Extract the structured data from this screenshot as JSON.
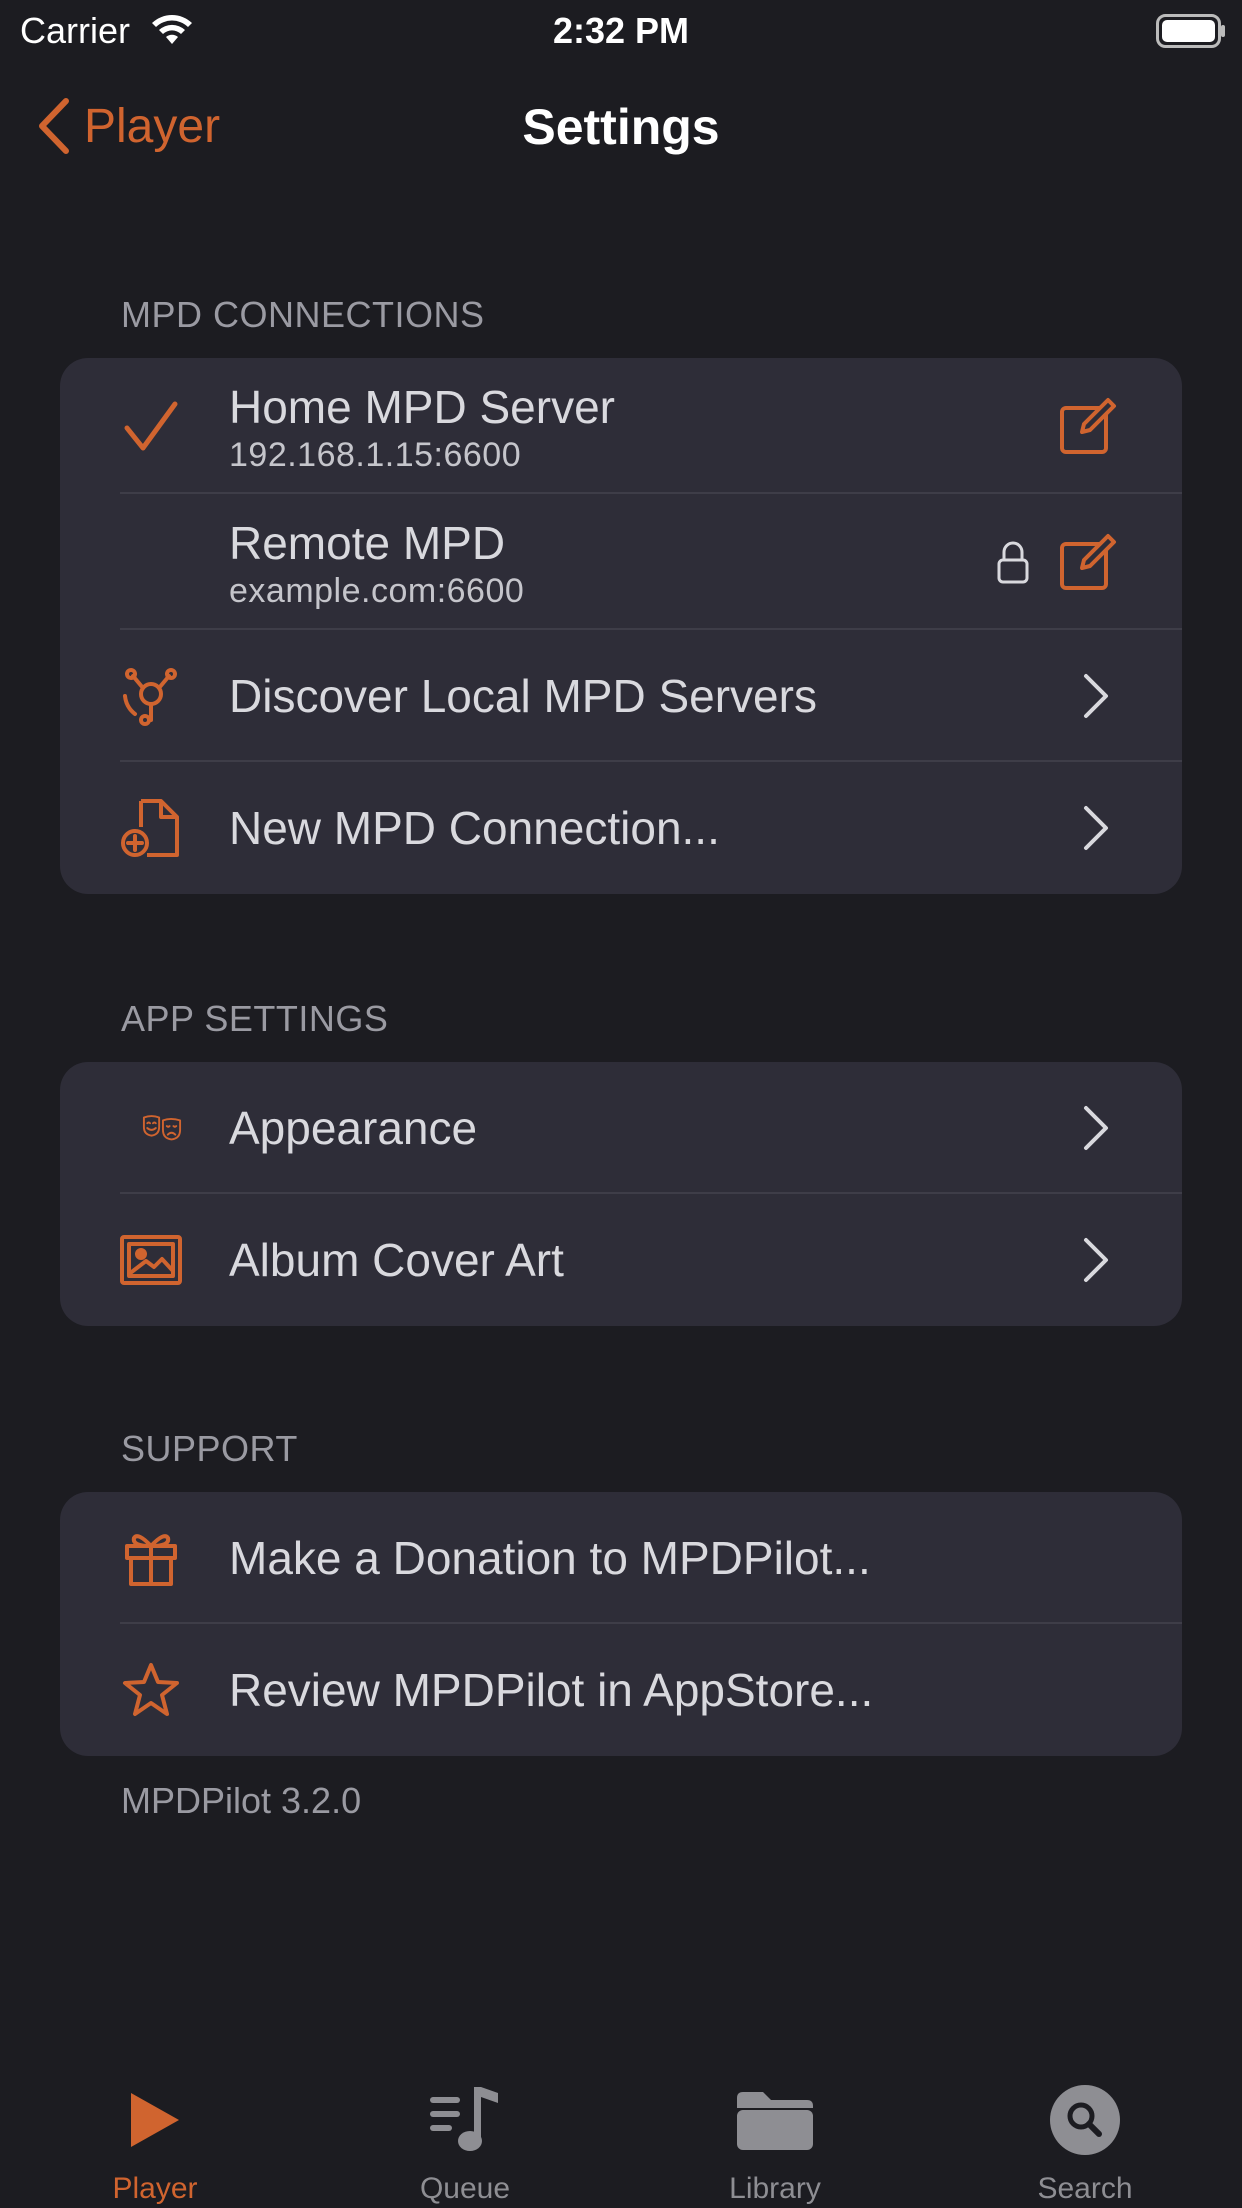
{
  "status_bar": {
    "carrier": "Carrier",
    "time": "2:32 PM"
  },
  "nav": {
    "back_label": "Player",
    "title": "Settings"
  },
  "sections": {
    "connections": {
      "header": "MPD CONNECTIONS",
      "servers": [
        {
          "name": "Home MPD Server",
          "address": "192.168.1.15:6600",
          "selected": true,
          "locked": false
        },
        {
          "name": "Remote MPD",
          "address": "example.com:6600",
          "selected": false,
          "locked": true
        }
      ],
      "discover_label": "Discover Local MPD Servers",
      "new_connection_label": "New MPD Connection..."
    },
    "app_settings": {
      "header": "APP SETTINGS",
      "appearance_label": "Appearance",
      "album_art_label": "Album Cover Art"
    },
    "support": {
      "header": "SUPPORT",
      "donation_label": "Make a Donation to MPDPilot...",
      "review_label": "Review MPDPilot in AppStore..."
    }
  },
  "version": "MPDPilot 3.2.0",
  "tabs": [
    {
      "label": "Player",
      "icon": "play-icon",
      "active": true
    },
    {
      "label": "Queue",
      "icon": "queue-icon",
      "active": false
    },
    {
      "label": "Library",
      "icon": "folder-icon",
      "active": false
    },
    {
      "label": "Search",
      "icon": "search-icon",
      "active": false
    }
  ],
  "colors": {
    "accent": "#d0642f",
    "background": "#1c1c21",
    "group": "#2e2d38",
    "inactive": "#8e8e93"
  }
}
